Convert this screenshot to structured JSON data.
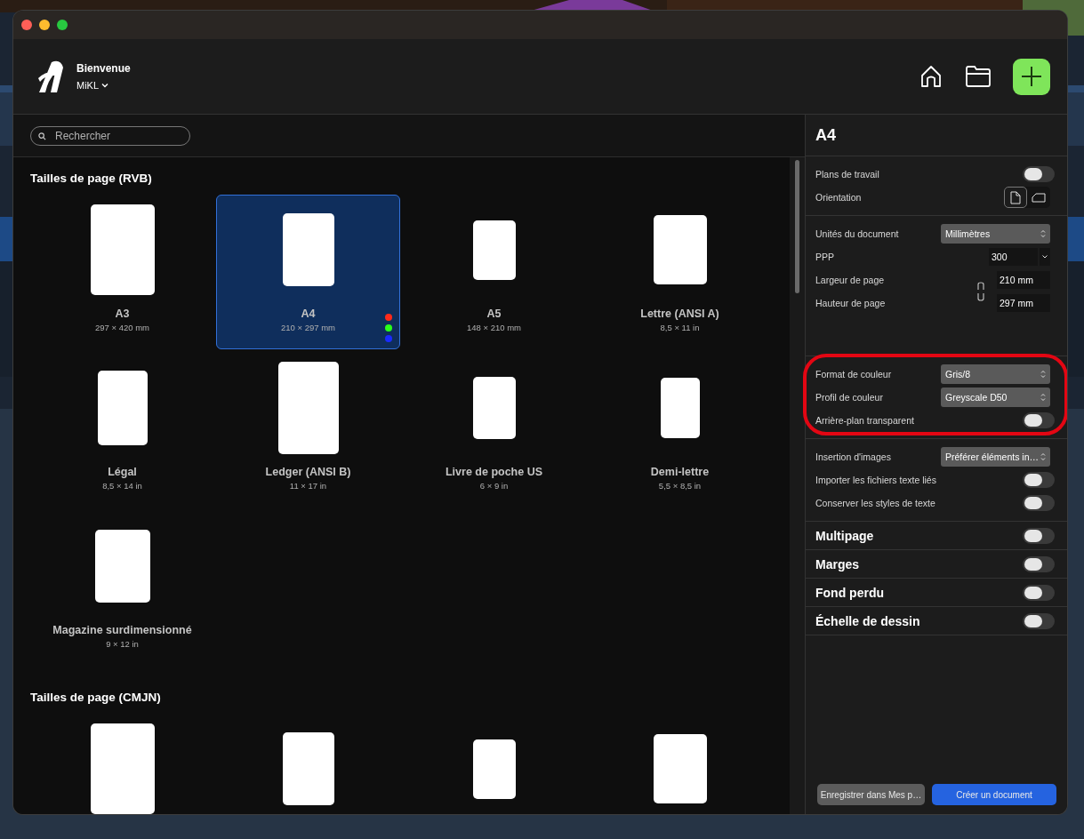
{
  "header": {
    "title": "Bienvenue",
    "user": "MiKL"
  },
  "search": {
    "placeholder": "Rechercher"
  },
  "sections": [
    {
      "title": "Tailles de page (RVB)",
      "items": [
        {
          "name": "A3",
          "size": "297 × 420 mm",
          "kind": "a3",
          "selected": false
        },
        {
          "name": "A4",
          "size": "210 × 297 mm",
          "kind": "a4",
          "selected": true
        },
        {
          "name": "A5",
          "size": "148 × 210 mm",
          "kind": "a5",
          "selected": false
        },
        {
          "name": "Lettre (ANSI A)",
          "size": "8,5 × 11 in",
          "kind": "letter",
          "selected": false
        },
        {
          "name": "Légal",
          "size": "8,5 × 14 in",
          "kind": "legal",
          "selected": false
        },
        {
          "name": "Ledger (ANSI B)",
          "size": "11 × 17 in",
          "kind": "ledger",
          "selected": false
        },
        {
          "name": "Livre de poche US",
          "size": "6 × 9 in",
          "kind": "pocket",
          "selected": false
        },
        {
          "name": "Demi-lettre",
          "size": "5,5 × 8,5 in",
          "kind": "halfletter",
          "selected": false
        },
        {
          "name": "Magazine surdimensionné",
          "size": "9 × 12 in",
          "kind": "magazine",
          "selected": false
        }
      ]
    },
    {
      "title": "Tailles de page (CMJN)",
      "items": [
        {
          "kind": "a3",
          "selected": false
        },
        {
          "kind": "a4",
          "selected": false
        },
        {
          "kind": "a5",
          "selected": false
        },
        {
          "kind": "letter",
          "selected": false
        }
      ]
    }
  ],
  "panel": {
    "title": "A4",
    "groups": [
      {
        "highlighted": false,
        "rows": [
          {
            "kind": "toggle",
            "label": "Plans de travail",
            "on": false
          },
          {
            "kind": "orientation",
            "label": "Orientation",
            "options": [
              {
                "kind": "portrait",
                "selected": true
              },
              {
                "kind": "landscape",
                "selected": false
              }
            ]
          }
        ]
      },
      {
        "highlighted": false,
        "rows": [
          {
            "kind": "select",
            "label": "Unités du document",
            "value": "Millimètres"
          },
          {
            "kind": "number",
            "label": "PPP",
            "value": "300"
          },
          {
            "kind": "dimensions",
            "fields": [
              {
                "label": "Largeur de page",
                "value": "210 mm"
              },
              {
                "label": "Hauteur de page",
                "value": "297 mm"
              }
            ]
          }
        ]
      },
      {
        "highlighted": true,
        "rows": [
          {
            "kind": "select",
            "label": "Format de couleur",
            "value": "Gris/8"
          },
          {
            "kind": "select",
            "label": "Profil de couleur",
            "value": "Greyscale D50"
          },
          {
            "kind": "toggle",
            "label": "Arrière-plan transparent",
            "on": false
          }
        ]
      },
      {
        "highlighted": false,
        "rows": [
          {
            "kind": "select",
            "label": "Insertion d'images",
            "value": "Préférer éléments in…"
          },
          {
            "kind": "toggle",
            "label": "Importer les fichiers texte liés",
            "on": false
          },
          {
            "kind": "toggle",
            "label": "Conserver les styles de texte",
            "on": false
          }
        ]
      }
    ],
    "options": [
      {
        "label": "Multipage",
        "on": false
      },
      {
        "label": "Marges",
        "on": false
      },
      {
        "label": "Fond perdu",
        "on": false
      },
      {
        "label": "Échelle de dessin",
        "on": false
      }
    ],
    "buttons": [
      {
        "label": "Enregistrer dans Mes p…",
        "kind": "secondary"
      },
      {
        "label": "Créer un document",
        "kind": "primary"
      }
    ]
  }
}
